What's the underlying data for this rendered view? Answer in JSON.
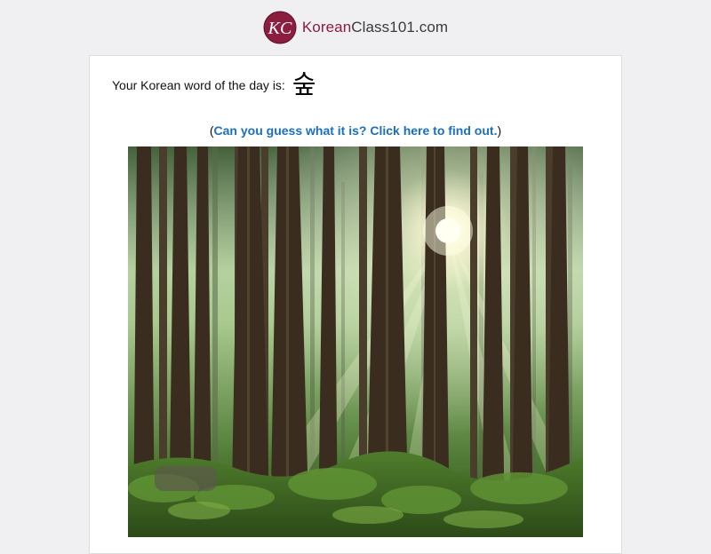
{
  "header": {
    "logo": {
      "monogram": "KC",
      "brand": "Korean",
      "rest": "Class101.com",
      "brand_color": "#8b1d3f"
    }
  },
  "word_of_day": {
    "label": "Your Korean word of the day is:",
    "word": "숲"
  },
  "guess": {
    "open_paren": "(",
    "link_text": "Can you guess what it is? Click here to find out.",
    "close_paren": ")",
    "link_color": "#1a6fc0"
  },
  "photo": {
    "subject": "forest-trees-sunlight"
  }
}
